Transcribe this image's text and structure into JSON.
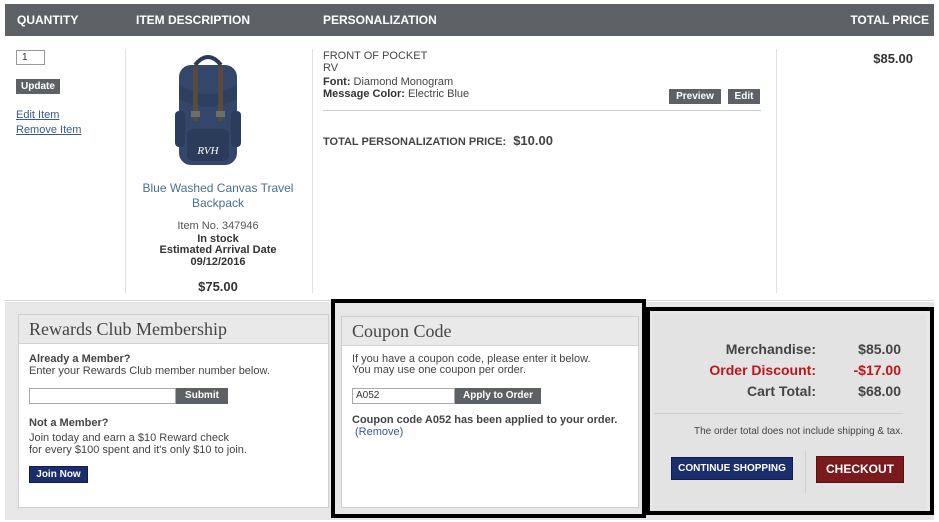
{
  "header": {
    "quantity": "QUANTITY",
    "item_description": "ITEM DESCRIPTION",
    "personalization": "PERSONALIZATION",
    "total_price": "TOTAL PRICE"
  },
  "item": {
    "quantity": "1",
    "update_label": "Update",
    "edit_label": "Edit Item",
    "remove_label": "Remove Item",
    "name_line1": "Blue Washed Canvas Travel",
    "name_line2": "Backpack",
    "item_no": "Item No. 347946",
    "stock": "In stock",
    "arrival_label": "Estimated Arrival Date",
    "arrival_date": "09/12/2016",
    "price": "$75.00",
    "total_price": "$85.00",
    "monogram": "RVH"
  },
  "personalization": {
    "location": "FRONT OF POCKET",
    "text": "RV",
    "font_label": "Font:",
    "font_value": "Diamond Monogram",
    "color_label": "Message Color:",
    "color_value": "Electric Blue",
    "preview_label": "Preview",
    "edit_label": "Edit",
    "total_label": "TOTAL PERSONALIZATION PRICE:",
    "total_value": "$10.00"
  },
  "rewards": {
    "title": "Rewards Club Membership",
    "member_heading": "Already a Member?",
    "member_text": "Enter your Rewards Club member number below.",
    "member_input": "",
    "submit_label": "Submit",
    "nonmember_heading": "Not a Member?",
    "nonmember_line1": "Join today and earn a $10 Reward check",
    "nonmember_line2": "for every $100 spent and it's only $10 to join.",
    "join_label": "Join Now"
  },
  "coupon": {
    "title": "Coupon Code",
    "line1": "If you have a coupon code, please enter it below.",
    "line2": "You may use one coupon per order.",
    "code": "A052",
    "apply_label": "Apply to Order",
    "applied_msg": "Coupon code A052 has been applied to your order.",
    "remove_label": "Remove"
  },
  "summary": {
    "merch_label": "Merchandise:",
    "merch_value": "$85.00",
    "discount_label": "Order Discount:",
    "discount_value": "-$17.00",
    "total_label": "Cart Total:",
    "total_value": "$68.00",
    "note": "The order total does not include shipping & tax.",
    "continue_label": "CONTINUE SHOPPING",
    "checkout_label": "CHECKOUT"
  },
  "colors": {
    "header_bg": "#5d6166",
    "discount": "#c0141a",
    "link": "#3a5a8c",
    "continue_btn": "#1a2e6e",
    "checkout_btn": "#7a1a1c"
  }
}
